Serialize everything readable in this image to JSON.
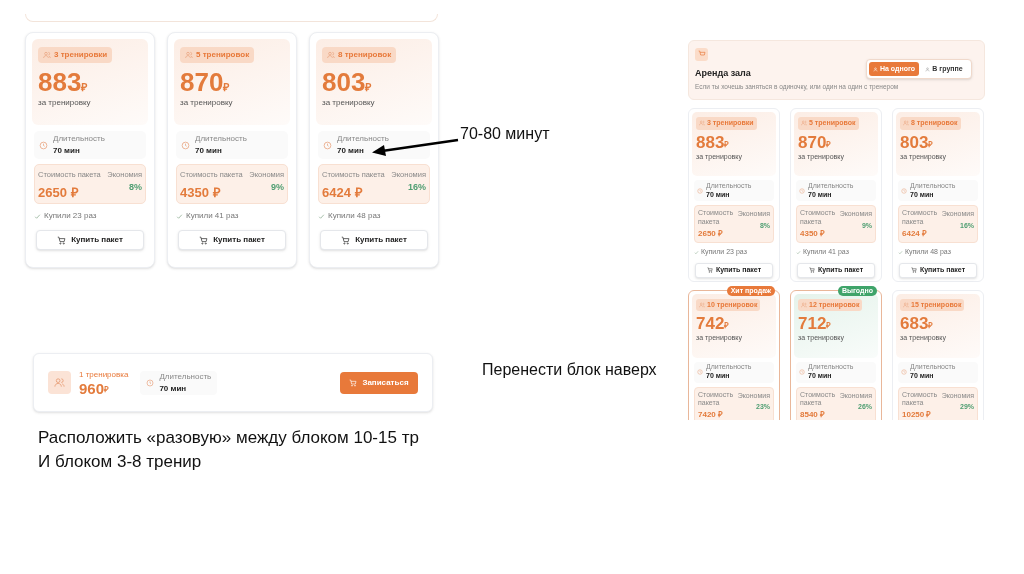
{
  "left_screenshot": {
    "cards": [
      {
        "badge": "3 тренировки",
        "price": "883",
        "currency": "₽",
        "per": "за тренировку",
        "duration_label": "Длительность",
        "duration": "70 мин",
        "package_label": "Стоимость пакета",
        "package_price": "2650 ₽",
        "savings_label": "Экономия",
        "savings": "8%",
        "bought": "Купили 23 раз",
        "button": "Купить пакет"
      },
      {
        "badge": "5 тренировок",
        "price": "870",
        "currency": "₽",
        "per": "за тренировку",
        "duration_label": "Длительность",
        "duration": "70 мин",
        "package_label": "Стоимость пакета",
        "package_price": "4350 ₽",
        "savings_label": "Экономия",
        "savings": "9%",
        "bought": "Купили 41 раз",
        "button": "Купить пакет"
      },
      {
        "badge": "8 тренировок",
        "price": "803",
        "currency": "₽",
        "per": "за тренировку",
        "duration_label": "Длительность",
        "duration": "70 мин",
        "package_label": "Стоимость пакета",
        "package_price": "6424 ₽",
        "savings_label": "Экономия",
        "savings": "16%",
        "bought": "Купили 48 раз",
        "button": "Купить пакет"
      }
    ]
  },
  "single_session": {
    "badge": "1 тренировка",
    "price": "960",
    "currency": "₽",
    "duration_label": "Длительность",
    "duration": "70 мин",
    "button": "Записаться"
  },
  "notes": [
    {
      "kind": "arrow",
      "text": "70-80 минут"
    },
    {
      "kind": "plain",
      "text": "Перенести блок наверх"
    },
    {
      "kind": "plain",
      "text": "Расположить «разовую» между блоком 10-15 тр\nИ блоком 3-8 тренир"
    }
  ],
  "right_screenshot": {
    "header": {
      "title": "Аренда зала",
      "subtitle": "Если ты хочешь заняться в одиночку, или один на один с тренером",
      "toggle": [
        {
          "label": "На одного",
          "selected": true
        },
        {
          "label": "В группе",
          "selected": false
        }
      ]
    },
    "cards": [
      {
        "badge": "3 тренировки",
        "price": "883",
        "currency": "₽",
        "per": "за тренировку",
        "duration_label": "Длительность",
        "duration": "70 мин",
        "package_label": "Стоимость пакета",
        "package_price": "2650 ₽",
        "savings_label": "Экономия",
        "savings": "8%",
        "bought": "Купили 23 раз",
        "button": "Купить пакет"
      },
      {
        "badge": "5 тренировок",
        "price": "870",
        "currency": "₽",
        "per": "за тренировку",
        "duration_label": "Длительность",
        "duration": "70 мин",
        "package_label": "Стоимость пакета",
        "package_price": "4350 ₽",
        "savings_label": "Экономия",
        "savings": "9%",
        "bought": "Купили 41 раз",
        "button": "Купить пакет"
      },
      {
        "badge": "8 тренировок",
        "price": "803",
        "currency": "₽",
        "per": "за тренировку",
        "duration_label": "Длительность",
        "duration": "70 мин",
        "package_label": "Стоимость пакета",
        "package_price": "6424 ₽",
        "savings_label": "Экономия",
        "savings": "16%",
        "bought": "Купили 48 раз",
        "button": "Купить пакет"
      },
      {
        "badge": "10 тренировок",
        "tag": {
          "label": "Хит продаж",
          "color": "#e8793a"
        },
        "price": "742",
        "currency": "₽",
        "per": "за тренировку",
        "duration_label": "Длительность",
        "duration": "70 мин",
        "package_label": "Стоимость пакета",
        "package_price": "7420 ₽",
        "savings_label": "Экономия",
        "savings": "23%"
      },
      {
        "badge": "12 тренировок",
        "tag": {
          "label": "Выгодно",
          "color": "#3fa46a"
        },
        "price": "712",
        "currency": "₽",
        "per": "за тренировку",
        "duration_label": "Длительность",
        "duration": "70 мин",
        "package_label": "Стоимость пакета",
        "package_price": "8540 ₽",
        "savings_label": "Экономия",
        "savings": "26%"
      },
      {
        "badge": "15 тренировок",
        "price": "683",
        "currency": "₽",
        "per": "за тренировку",
        "duration_label": "Длительность",
        "duration": "70 мин",
        "package_label": "Стоимость пакета",
        "package_price": "10250 ₽",
        "savings_label": "Экономия",
        "savings": "29%"
      }
    ]
  }
}
